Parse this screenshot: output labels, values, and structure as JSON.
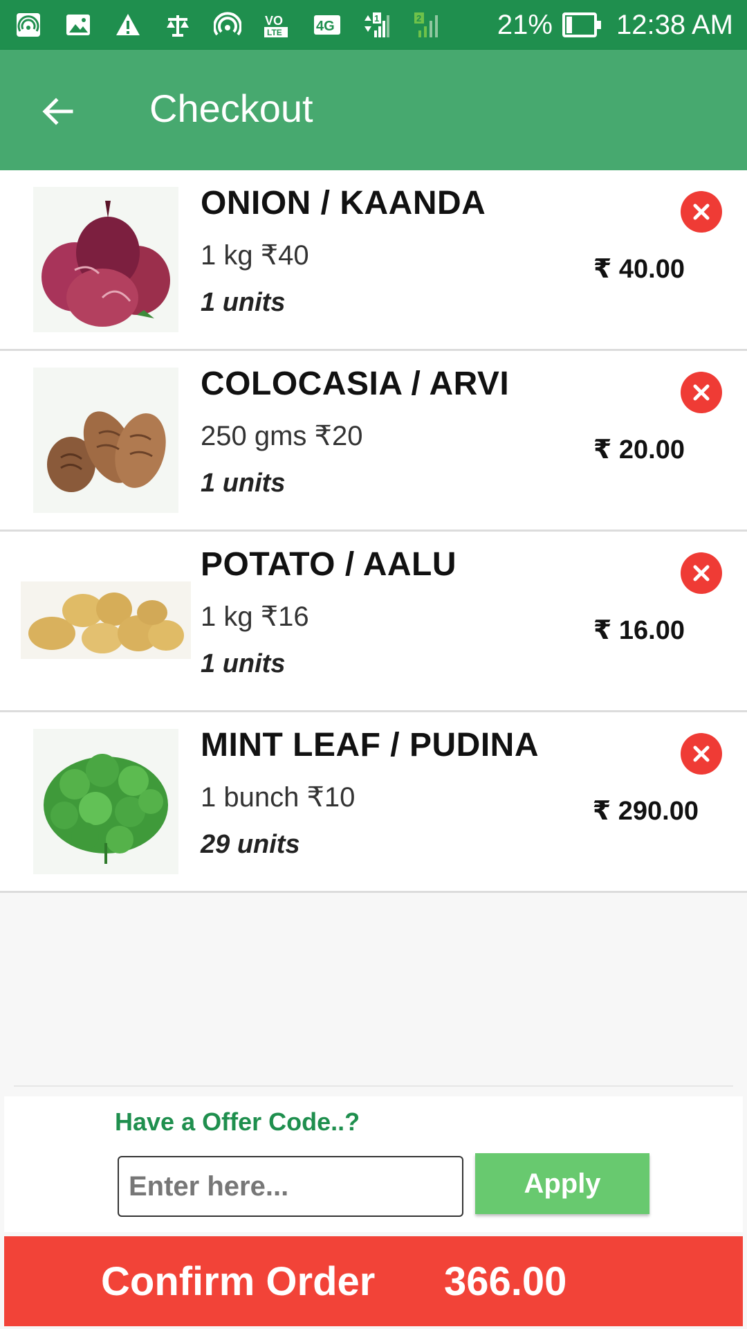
{
  "status_bar": {
    "network_4g": "4G",
    "sim1": "1",
    "sim2": "2",
    "volte": "VO LTE",
    "battery": "21%",
    "battery_level": 0.21,
    "time": "12:38 AM"
  },
  "app_bar": {
    "title": "Checkout"
  },
  "items": [
    {
      "name": "ONION / KAANDA",
      "price_line": "1 kg ₹40",
      "units": "1 units",
      "total": "₹ 40.00",
      "image": "onion"
    },
    {
      "name": "COLOCASIA / ARVI",
      "price_line": "250 gms ₹20",
      "units": "1 units",
      "total": "₹ 20.00",
      "image": "colocasia"
    },
    {
      "name": "POTATO / AALU",
      "price_line": "1 kg ₹16",
      "units": "1 units",
      "total": "₹ 16.00",
      "image": "potato"
    },
    {
      "name": "MINT LEAF / PUDINA",
      "price_line": "1 bunch ₹10",
      "units": "29 units",
      "total": "₹ 290.00",
      "image": "mint"
    }
  ],
  "offer": {
    "label": "Have a Offer Code..?",
    "placeholder": "Enter here...",
    "apply_label": "Apply"
  },
  "confirm": {
    "label": "Confirm Order",
    "amount": "366.00"
  },
  "colors": {
    "status_bar": "#1f8f4e",
    "app_bar": "#47a96f",
    "remove": "#ef3b35",
    "apply": "#68c96f",
    "confirm": "#f24338",
    "offer_label": "#1f8f4e"
  }
}
